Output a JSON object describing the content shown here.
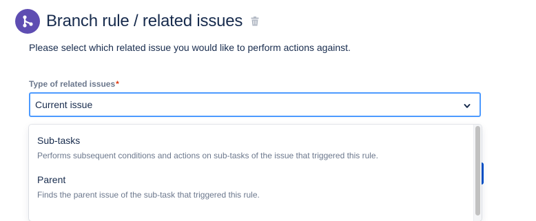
{
  "header": {
    "title": "Branch rule / related issues",
    "icon": "branch-icon",
    "badge_color": "#5e4db2",
    "delete_icon": "trash-icon"
  },
  "description": "Please select which related issue you would like to perform actions against.",
  "field": {
    "label": "Type of related issues",
    "required_marker": "*",
    "selected_value": "Current issue",
    "focus_color": "#4c9aff"
  },
  "menu": {
    "options": [
      {
        "label": "Sub-tasks",
        "description": "Performs subsequent conditions and actions on sub-tasks of the issue that triggered this rule."
      },
      {
        "label": "Parent",
        "description": "Finds the parent issue of the sub-task that triggered this rule."
      }
    ]
  }
}
